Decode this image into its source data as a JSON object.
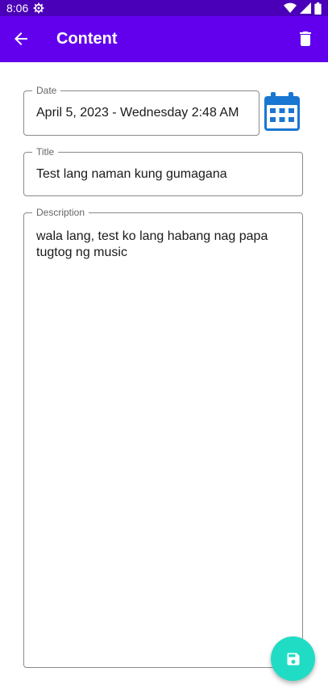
{
  "status_bar": {
    "time": "8:06"
  },
  "app_bar": {
    "title": "Content"
  },
  "form": {
    "date": {
      "label": "Date",
      "value": "April 5, 2023 - Wednesday 2:48 AM"
    },
    "title": {
      "label": "Title",
      "value": "Test lang naman kung gumagana"
    },
    "description": {
      "label": "Description",
      "value": "wala lang, test ko lang habang nag papa tugtog ng music"
    }
  },
  "colors": {
    "app_bar": "#6200ee",
    "status_bar": "#4a00b8",
    "fab": "#20dcc5",
    "calendar": "#1976d2"
  },
  "icons": {
    "status": [
      "gear-icon",
      "wifi-icon",
      "signal-icon",
      "battery-icon"
    ],
    "app_bar": [
      "back-arrow-icon",
      "trash-icon"
    ],
    "form": [
      "calendar-icon"
    ],
    "fab": "save-icon"
  }
}
